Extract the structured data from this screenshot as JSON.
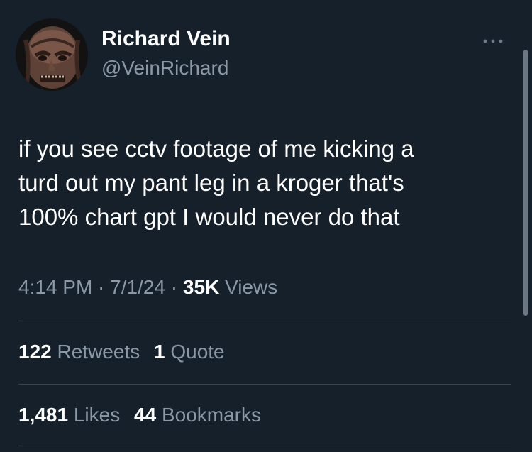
{
  "author": {
    "display_name": "Richard Vein",
    "handle": "@VeinRichard"
  },
  "tweet": {
    "lines": [
      "if you see cctv footage of me kicking a",
      "turd out my pant leg in a kroger that's",
      "100%  chart gpt I would never do that"
    ]
  },
  "meta": {
    "time": "4:14 PM",
    "sep1": " · ",
    "date": "7/1/24",
    "sep2": " · ",
    "views_count": "35K",
    "views_label": " Views"
  },
  "stats": {
    "retweets_count": "122",
    "retweets_label": " Retweets",
    "quotes_count": "1",
    "quotes_label": " Quote",
    "likes_count": "1,481",
    "likes_label": " Likes",
    "bookmarks_count": "44",
    "bookmarks_label": " Bookmarks"
  },
  "icons": {
    "more": "more-options-icon"
  },
  "colors": {
    "background": "#15202b",
    "secondary_text": "#8b98a5",
    "divider": "#38444d"
  }
}
